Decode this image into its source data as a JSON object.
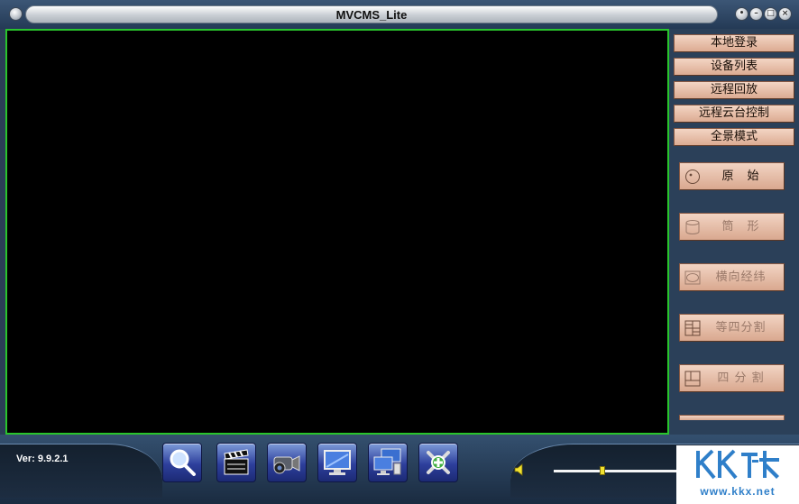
{
  "window": {
    "title": "MVCMS_Lite"
  },
  "side_menu": {
    "items": [
      {
        "label": "本地登录"
      },
      {
        "label": "设备列表"
      },
      {
        "label": "远程回放"
      },
      {
        "label": "远程云台控制"
      },
      {
        "label": "全景模式"
      }
    ]
  },
  "view_modes": [
    {
      "label": "原　始",
      "icon": "circle-icon",
      "enabled": true
    },
    {
      "label": "筒　形",
      "icon": "cylinder-icon",
      "enabled": false
    },
    {
      "label": "横向经纬",
      "icon": "ellipse-icon",
      "enabled": false
    },
    {
      "label": "等四分割",
      "icon": "quad-grid-icon",
      "enabled": false
    },
    {
      "label": "四 分 割",
      "icon": "split-grid-icon",
      "enabled": false
    }
  ],
  "footer": {
    "version": "Ver: 9.9.2.1",
    "toolbar": [
      {
        "icon": "magnifier-icon"
      },
      {
        "icon": "clapperboard-icon"
      },
      {
        "icon": "video-camera-icon"
      },
      {
        "icon": "monitor-icon"
      },
      {
        "icon": "multi-monitor-icon"
      },
      {
        "icon": "tools-icon"
      }
    ],
    "volume_fraction": 0.4
  },
  "watermark": {
    "logo": "KK下载",
    "url": "www.kkx.net"
  },
  "colors": {
    "video_border": "#29c42c",
    "button_fill": "#e8bca6",
    "slider_thumb": "#f2e330"
  }
}
